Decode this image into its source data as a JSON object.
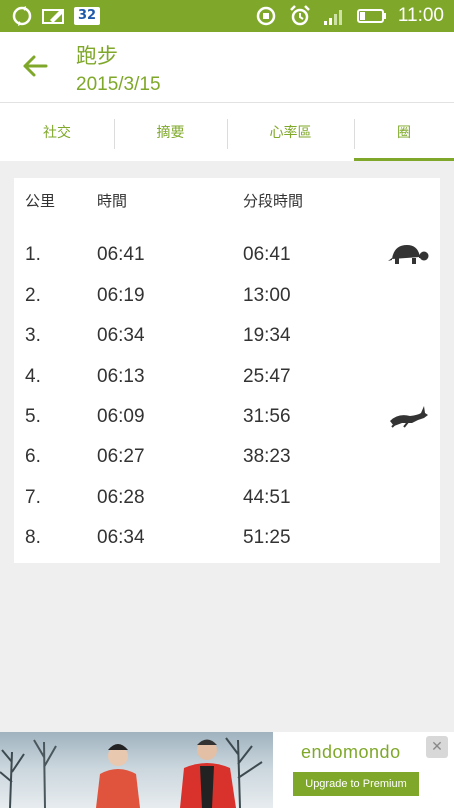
{
  "status_bar": {
    "notification_count": "32",
    "time": "11:00"
  },
  "header": {
    "title": "跑步",
    "date": "2015/3/15"
  },
  "tabs": [
    {
      "label": "社交",
      "active": false
    },
    {
      "label": "摘要",
      "active": false
    },
    {
      "label": "心率區",
      "active": false
    },
    {
      "label": "圈",
      "active": true
    }
  ],
  "laps_table": {
    "headers": {
      "km": "公里",
      "time": "時間",
      "split": "分段時間"
    },
    "rows": [
      {
        "km": "1.",
        "time": "06:41",
        "split": "06:41",
        "marker": "tortoise-icon"
      },
      {
        "km": "2.",
        "time": "06:19",
        "split": "13:00",
        "marker": ""
      },
      {
        "km": "3.",
        "time": "06:34",
        "split": "19:34",
        "marker": ""
      },
      {
        "km": "4.",
        "time": "06:13",
        "split": "25:47",
        "marker": ""
      },
      {
        "km": "5.",
        "time": "06:09",
        "split": "31:56",
        "marker": "hare-icon"
      },
      {
        "km": "6.",
        "time": "06:27",
        "split": "38:23",
        "marker": ""
      },
      {
        "km": "7.",
        "time": "06:28",
        "split": "44:51",
        "marker": ""
      },
      {
        "km": "8.",
        "time": "06:34",
        "split": "51:25",
        "marker": ""
      }
    ]
  },
  "ad": {
    "brand": "endomondo",
    "cta": "Upgrade to Premium"
  },
  "colors": {
    "accent": "#7fa82a",
    "background": "#efefef",
    "card": "#ffffff"
  }
}
